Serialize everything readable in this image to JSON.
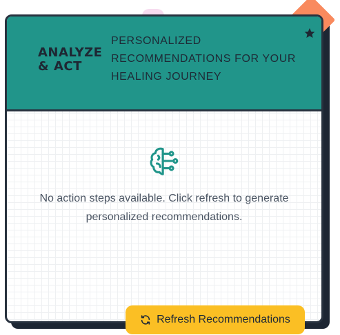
{
  "card": {
    "title": "ANALYZE & ACT",
    "subtitle": "PERSONALIZED RECOMMENDATIONS FOR YOUR HEALING JOURNEY",
    "empty_message": "No action steps available. Click refresh to generate personalized recommendations."
  },
  "actions": {
    "refresh_label": "Refresh Recommendations"
  },
  "icons": {
    "header": "star-icon",
    "empty_state": "brain-icon",
    "button": "refresh-icon"
  },
  "colors": {
    "header_bg": "#21958a",
    "accent_diamond": "#f98a5e",
    "button_bg": "#fbbf24",
    "border": "#28323f",
    "icon_teal": "#21958a"
  }
}
